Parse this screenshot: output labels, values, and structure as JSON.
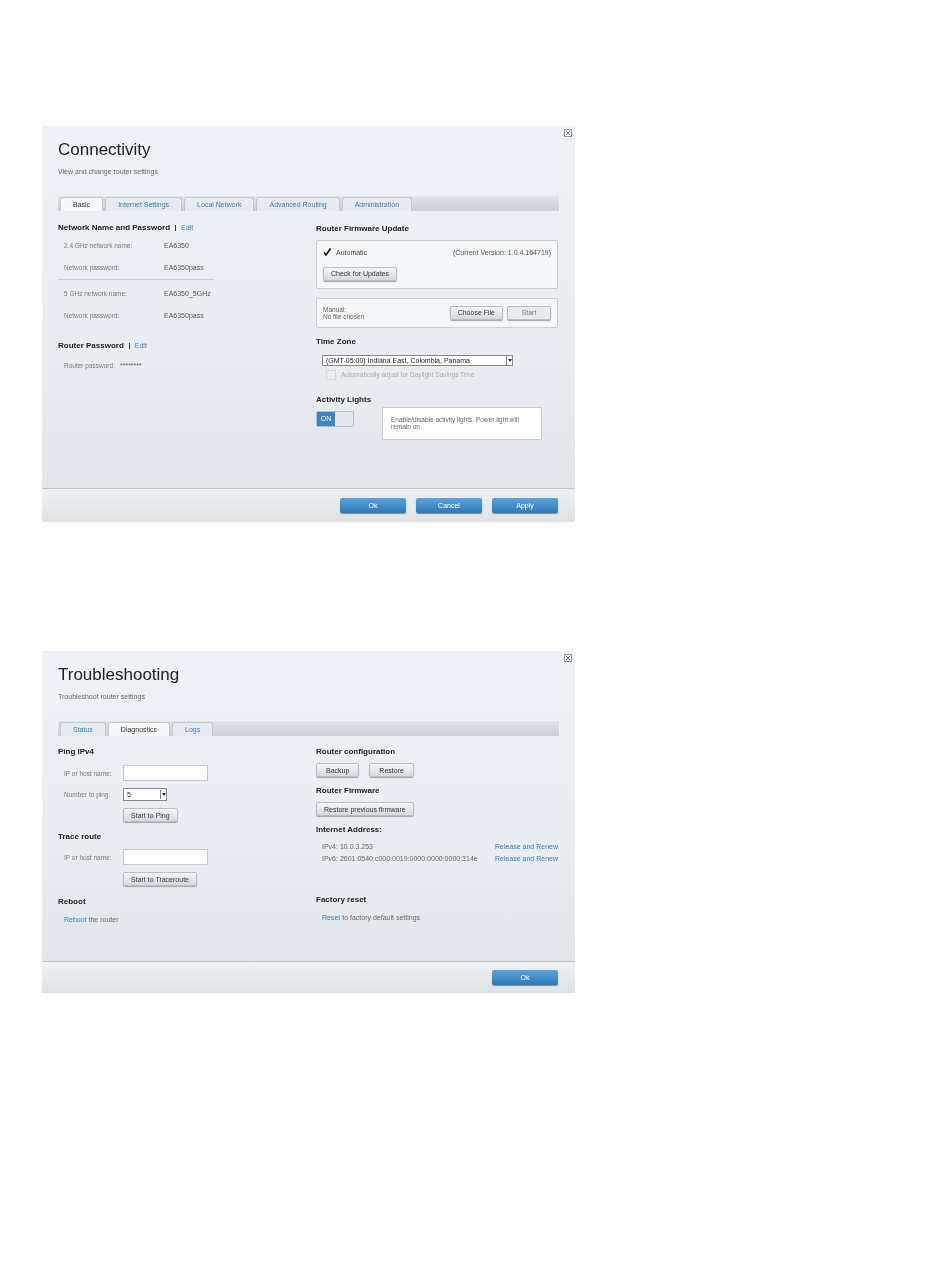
{
  "connectivity": {
    "title": "Connectivity",
    "subtitle": "View and change router settings",
    "tabs": [
      {
        "label": "Basic",
        "selected": true
      },
      {
        "label": "Internet Settings",
        "selected": false
      },
      {
        "label": "Local Network",
        "selected": false
      },
      {
        "label": "Advanced Routing",
        "selected": false
      },
      {
        "label": "Administration",
        "selected": false
      }
    ],
    "network": {
      "heading": "Network Name and Password",
      "edit": "Edit",
      "groups": [
        [
          {
            "label": "2.4 GHz network name:",
            "value": "EA6350"
          },
          {
            "label": "Network password:",
            "value": "EA6350pass"
          }
        ],
        [
          {
            "label": "5 GHz network name:",
            "value": "EA6350_5GHz"
          },
          {
            "label": "Network password:",
            "value": "EA6350pass"
          }
        ]
      ]
    },
    "router_password": {
      "heading": "Router Password",
      "edit": "Edit",
      "label": "Router password:",
      "value": "********"
    },
    "firmware": {
      "heading": "Router Firmware Update",
      "automatic": {
        "label": "Automatic",
        "checked": true
      },
      "current_version": "(Current Version: 1.0.4.164719)",
      "check_button": "Check for Updates",
      "manual_label": "Manual:",
      "file_status": "No file chosen",
      "choose_button": "Choose File",
      "start_button": {
        "label": "Start",
        "disabled": true
      }
    },
    "time_zone": {
      "heading": "Time Zone",
      "value": "(GMT-05:00) Indiana East, Colombia, Panama",
      "dst": {
        "label": "Automatically adjust for Daylight Savings Time",
        "checked": false,
        "disabled": true
      }
    },
    "activity_lights": {
      "heading": "Activity Lights",
      "toggle": {
        "label": "ON",
        "on": true
      },
      "note": "Enable/disable activity lights. Power light will remain on."
    },
    "buttons": [
      "Ok",
      "Cancel",
      "Apply"
    ]
  },
  "troubleshooting": {
    "title": "Troubleshooting",
    "subtitle": "Troubleshoot router settings",
    "tabs": [
      {
        "label": "Status",
        "selected": false
      },
      {
        "label": "Diagnostics",
        "selected": true
      },
      {
        "label": "Logs",
        "selected": false
      }
    ],
    "ping": {
      "heading": "Ping IPv4",
      "ip_label": "IP or host name:",
      "count_label": "Number to ping:",
      "count_value": "5",
      "button": "Start to Ping"
    },
    "trace": {
      "heading": "Trace route",
      "ip_label": "IP or host name:",
      "button": "Start to Traceroute"
    },
    "reboot": {
      "heading": "Reboot",
      "link": "Reboot",
      "text": " the router"
    },
    "config": {
      "heading": "Router configuration",
      "buttons": [
        "Backup",
        "Restore"
      ]
    },
    "firmware": {
      "heading": "Router Firmware",
      "button": "Restore previous firmware"
    },
    "internet": {
      "heading": "Internet Address:",
      "rows": [
        {
          "address": "IPv4: 10.0.3.253",
          "action": "Release and Renew"
        },
        {
          "address": "IPv6: 2601:0540:c000:0019:0000:0000:0000:314e",
          "action": "Release and Renew"
        }
      ]
    },
    "factory": {
      "heading": "Factory reset",
      "link": "Reset",
      "text": " to factory default settings"
    },
    "buttons": [
      "Ok"
    ]
  }
}
